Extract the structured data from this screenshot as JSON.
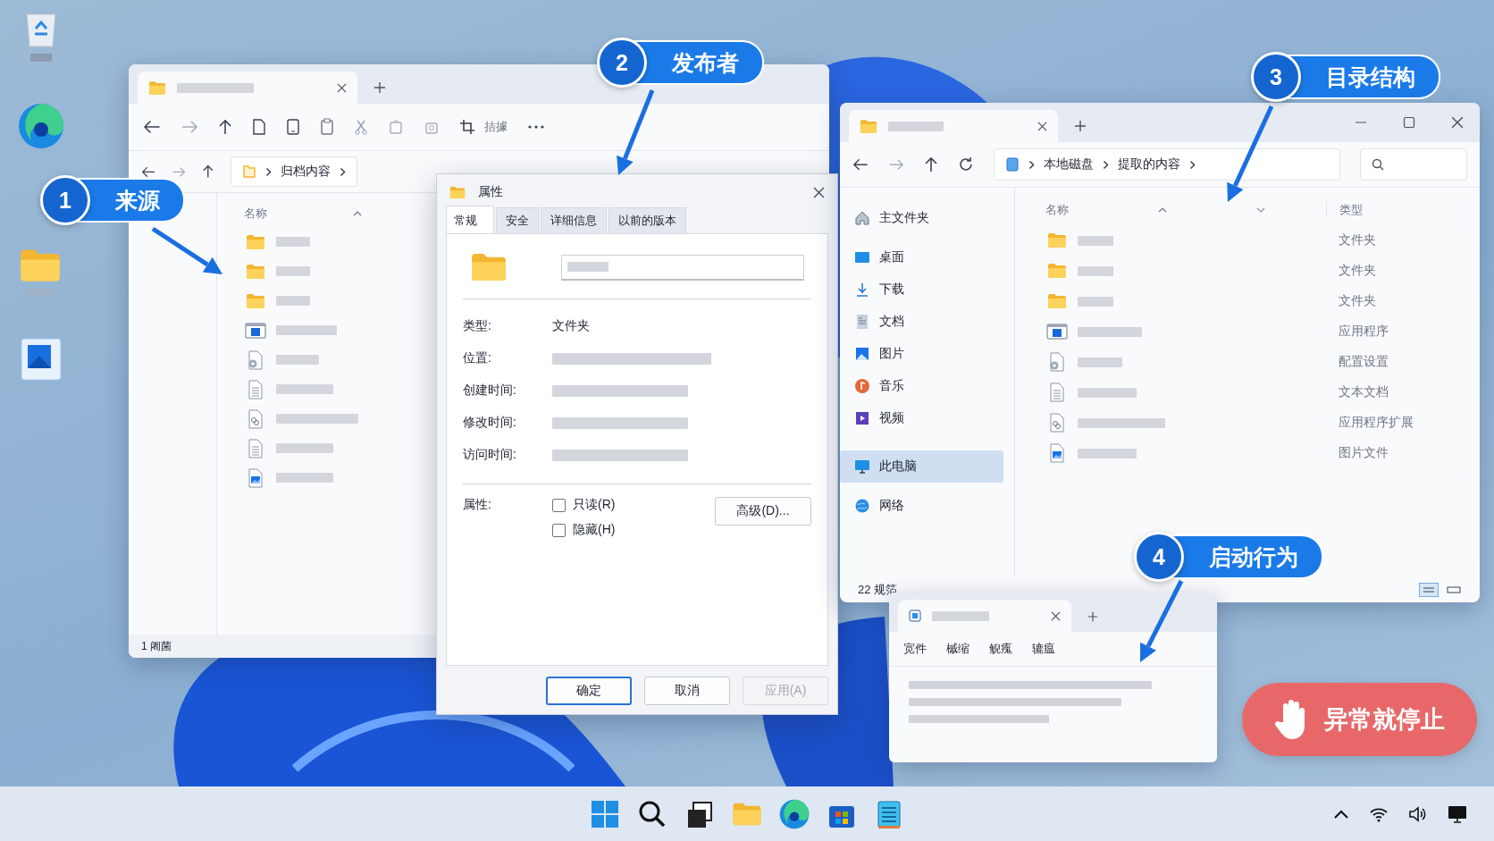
{
  "callouts": [
    {
      "number": "1",
      "label": "来源"
    },
    {
      "number": "2",
      "label": "发布者"
    },
    {
      "number": "3",
      "label": "目录结构"
    },
    {
      "number": "4",
      "label": "启动行为"
    }
  ],
  "source_window": {
    "toolbar_label": "拮據",
    "breadcrumb": [
      "归档内容"
    ],
    "column": "名称",
    "files": [
      {
        "kind": "folder"
      },
      {
        "kind": "folder"
      },
      {
        "kind": "folder"
      },
      {
        "kind": "app"
      },
      {
        "kind": "config"
      },
      {
        "kind": "text"
      },
      {
        "kind": "extension"
      },
      {
        "kind": "text"
      },
      {
        "kind": "image"
      }
    ],
    "status": "1 阇菌"
  },
  "properties_dialog": {
    "title": "属性",
    "tabs": [
      {
        "label": "常规",
        "selected": true
      },
      {
        "label": "安全",
        "selected": false
      },
      {
        "label": "详细信息",
        "selected": false
      },
      {
        "label": "以前的版本",
        "selected": false
      }
    ],
    "fields": [
      {
        "label": "类型:",
        "value": "文件夹"
      },
      {
        "label": "位置:"
      },
      {
        "label": "创建时间:"
      },
      {
        "label": "修改时间:"
      },
      {
        "label": "访问时间:"
      }
    ],
    "attributes_label": "属性:",
    "checkboxes": [
      {
        "label": "只读(R)",
        "checked": false
      },
      {
        "label": "隐藏(H)",
        "checked": false
      }
    ],
    "advanced_button": "高级(D)...",
    "buttons": [
      {
        "label": "确定",
        "default": true,
        "disabled": false
      },
      {
        "label": "取消",
        "default": false,
        "disabled": false
      },
      {
        "label": "应用(A)",
        "default": false,
        "disabled": true
      }
    ]
  },
  "target_window": {
    "breadcrumb": [
      "本地磁盘",
      "提取的内容"
    ],
    "sidebar": [
      {
        "label": "主文件夹",
        "selected": false
      },
      {
        "label": "桌面",
        "selected": false
      },
      {
        "label": "下载",
        "selected": false
      },
      {
        "label": "文档",
        "selected": false
      },
      {
        "label": "图片",
        "selected": false
      },
      {
        "label": "音乐",
        "selected": false
      },
      {
        "label": "视频",
        "selected": false
      },
      {
        "label": "此电脑",
        "selected": true
      },
      {
        "label": "网络",
        "selected": false
      }
    ],
    "columns": [
      "名称",
      "类型"
    ],
    "files": [
      {
        "kind": "folder",
        "type": "文件夹"
      },
      {
        "kind": "folder",
        "type": "文件夹"
      },
      {
        "kind": "folder",
        "type": "文件夹"
      },
      {
        "kind": "app",
        "type": "应用程序"
      },
      {
        "kind": "config",
        "type": "配置设置"
      },
      {
        "kind": "text",
        "type": "文本文档"
      },
      {
        "kind": "extension",
        "type": "应用程序扩展"
      },
      {
        "kind": "image",
        "type": "图片文件"
      }
    ],
    "status": "22 规箔"
  },
  "notepad_window": {
    "menu": [
      "宽件",
      "槭缩",
      "鲵瘣",
      "辘瘟"
    ]
  },
  "stop_badge": {
    "label": "异常就停止"
  }
}
